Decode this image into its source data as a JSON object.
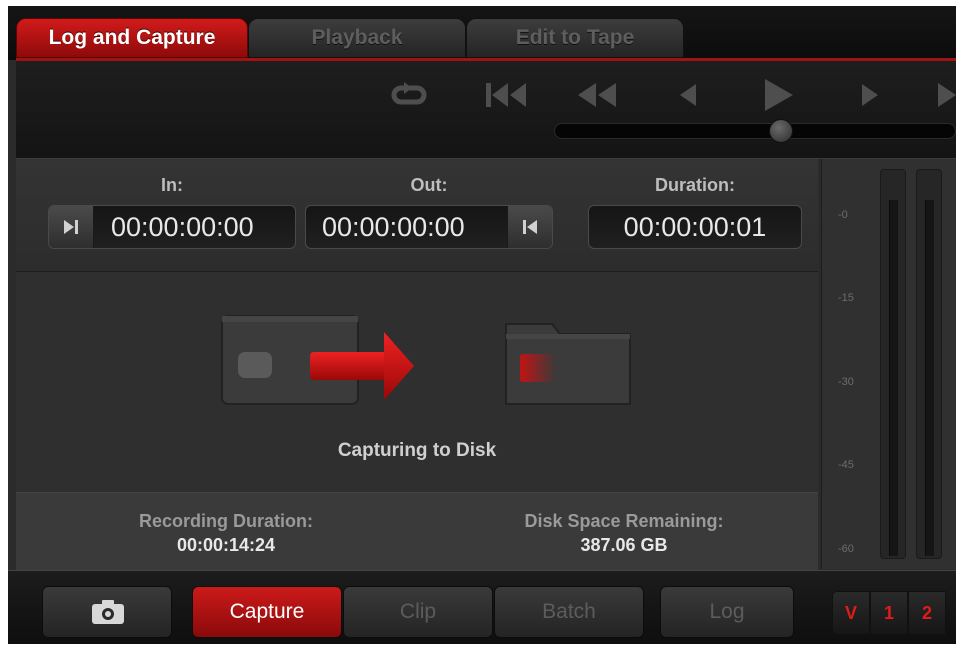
{
  "tabs": [
    {
      "label": "Log and Capture",
      "active": true
    },
    {
      "label": "Playback",
      "active": false
    },
    {
      "label": "Edit to Tape",
      "active": false
    }
  ],
  "transport": {
    "scrub_position": 0.55,
    "buttons": [
      "loop-icon",
      "jump-to-start-icon",
      "rewind-icon",
      "step-back-icon",
      "play-icon",
      "step-forward-icon",
      "fast-forward-icon"
    ]
  },
  "timecode": {
    "in_label": "In:",
    "in_value": "00:00:00:00",
    "out_label": "Out:",
    "out_value": "00:00:00:00",
    "duration_label": "Duration:",
    "duration_value": "00:00:00:01"
  },
  "capture": {
    "status": "Capturing to Disk"
  },
  "stats": {
    "recording_duration_label": "Recording Duration:",
    "recording_duration_value": "00:00:14:24",
    "disk_space_label": "Disk Space Remaining:",
    "disk_space_value": "387.06 GB"
  },
  "meters": {
    "scale": [
      "-0",
      "-15",
      "-30",
      "-45",
      "-60"
    ]
  },
  "bottom": {
    "camera_icon": "camera-icon",
    "capture_label": "Capture",
    "clip_label": "Clip",
    "batch_label": "Batch",
    "log_label": "Log",
    "tracks": [
      "V",
      "1",
      "2"
    ]
  },
  "colors": {
    "accent_red": "#c8161a",
    "background": "#2b2b2b"
  }
}
